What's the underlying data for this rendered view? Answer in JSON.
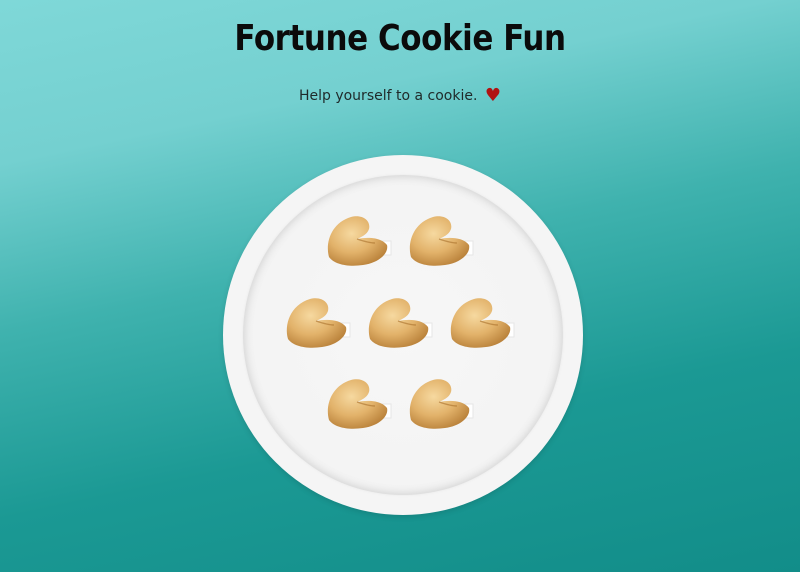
{
  "page": {
    "title": "Fortune Cookie Fun",
    "subtitle": "Help yourself to a cookie.",
    "subtitle_icon": "heart-icon"
  },
  "plate": {
    "cookies": [
      {
        "id": 1,
        "icon": "fortune-cookie-icon"
      },
      {
        "id": 2,
        "icon": "fortune-cookie-icon"
      },
      {
        "id": 3,
        "icon": "fortune-cookie-icon"
      },
      {
        "id": 4,
        "icon": "fortune-cookie-icon"
      },
      {
        "id": 5,
        "icon": "fortune-cookie-icon"
      },
      {
        "id": 6,
        "icon": "fortune-cookie-icon"
      },
      {
        "id": 7,
        "icon": "fortune-cookie-icon"
      }
    ]
  },
  "colors": {
    "background_top": "#7fd8d8",
    "background_bottom": "#128d89",
    "title": "#0b0b0b",
    "heart": "#b01212",
    "plate": "#f5f5f5",
    "cookie": "#d8a456"
  }
}
